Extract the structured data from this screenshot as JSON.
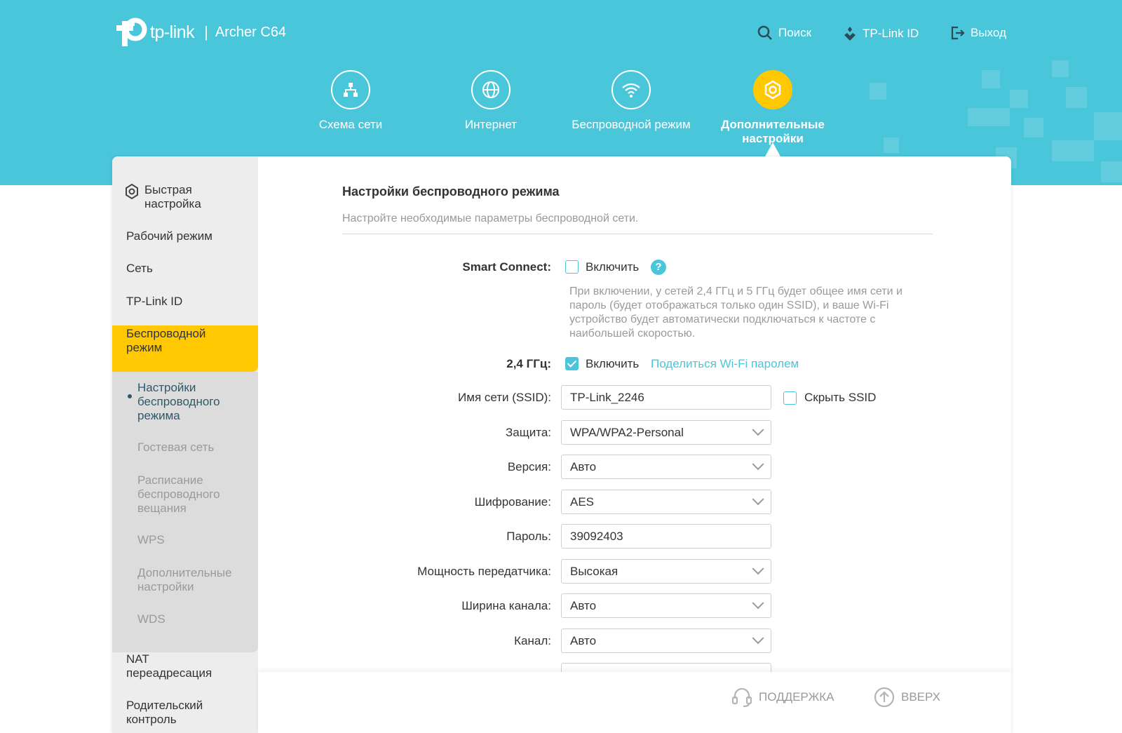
{
  "brand": {
    "logo_text": "tp-link",
    "separator": "|",
    "model": "Archer C64"
  },
  "topnav": {
    "search": "Поиск",
    "tplink_id": "TP-Link ID",
    "logout": "Выход"
  },
  "mainnav": [
    {
      "label": "Схема сети",
      "icon": "network-map-icon"
    },
    {
      "label": "Интернет",
      "icon": "globe-icon"
    },
    {
      "label": "Беспроводной режим",
      "icon": "wifi-icon"
    },
    {
      "label": "Дополнительные настройки",
      "icon": "gear-icon",
      "active": true
    }
  ],
  "sidebar": {
    "items": [
      {
        "label": "Быстрая настройка",
        "icon": "gear-icon"
      },
      {
        "label": "Рабочий режим"
      },
      {
        "label": "Сеть"
      },
      {
        "label": "TP-Link ID"
      },
      {
        "label": "Беспроводной режим",
        "active": true
      },
      {
        "label": "NAT переадресация"
      },
      {
        "label": "Родительский контроль"
      }
    ],
    "subitems": [
      {
        "label": "Настройки беспроводного режима",
        "current": true
      },
      {
        "label": "Гостевая сеть"
      },
      {
        "label": "Расписание беспроводного вещания"
      },
      {
        "label": "WPS"
      },
      {
        "label": "Дополнительные настройки"
      },
      {
        "label": "WDS"
      }
    ]
  },
  "main": {
    "title": "Настройки беспроводного режима",
    "subtitle": "Настройте необходимые параметры беспроводной сети.",
    "smart_connect": {
      "label": "Smart Connect:",
      "checkbox_label": "Включить",
      "checked": false,
      "help": "?",
      "hint": "При включении, у сетей 2,4 ГГц и 5 ГГц будет общее имя сети и пароль (будет отображаться только один SSID), и ваше Wi-Fi устройство будет автоматически подключаться к частоте с наибольшей скоростью."
    },
    "band_24": {
      "label": "2,4 ГГц:",
      "checkbox_label": "Включить",
      "checked": true,
      "share_link": "Поделиться Wi-Fi паролем"
    },
    "fields": {
      "ssid": {
        "label": "Имя сети (SSID):",
        "value": "TP-Link_2246",
        "hide_label": "Скрыть SSID",
        "hide_checked": false
      },
      "security": {
        "label": "Защита:",
        "value": "WPA/WPA2-Personal"
      },
      "version": {
        "label": "Версия:",
        "value": "Авто"
      },
      "encryption": {
        "label": "Шифрование:",
        "value": "AES"
      },
      "password": {
        "label": "Пароль:",
        "value": "39092403"
      },
      "tx_power": {
        "label": "Мощность передатчика:",
        "value": "Высокая"
      },
      "channel_width": {
        "label": "Ширина канала:",
        "value": "Авто"
      },
      "channel": {
        "label": "Канал:",
        "value": "Авто"
      }
    }
  },
  "footer": {
    "support": "ПОДДЕРЖКА",
    "top": "ВВЕРХ"
  },
  "colors": {
    "accent": "#4ac6da",
    "active": "#ffc800",
    "sidebar": "#ededed",
    "submenu": "#dcdcdc"
  }
}
